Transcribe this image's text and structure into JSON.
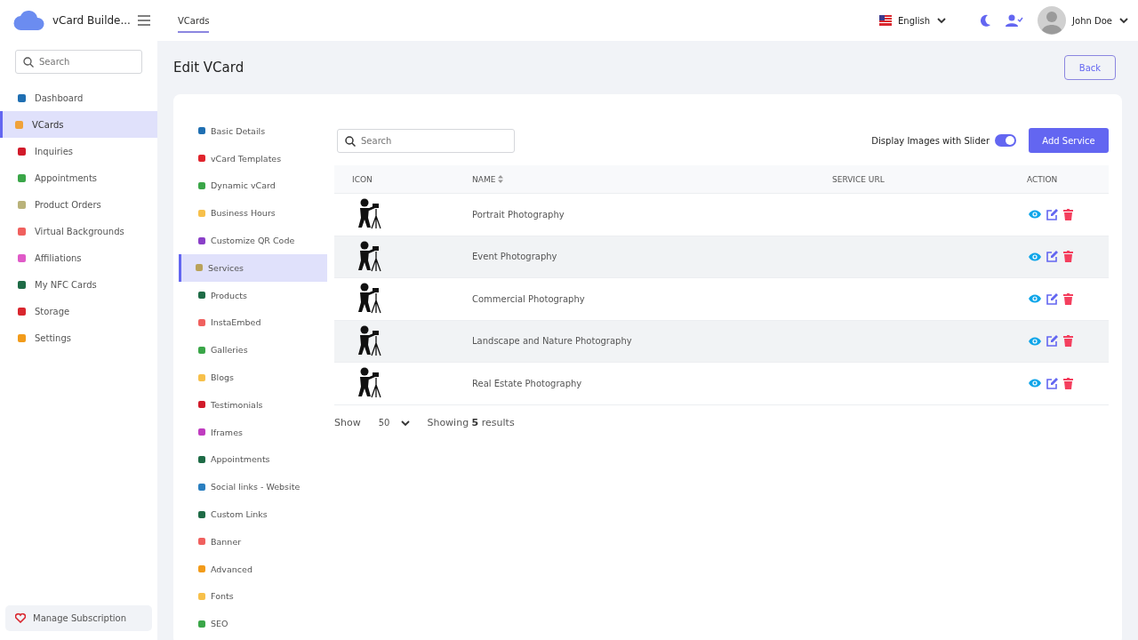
{
  "brand": {
    "name": "vCard Builde..."
  },
  "top_nav": [
    {
      "label": "VCards",
      "selected": true
    }
  ],
  "header": {
    "language": "English",
    "user": "John Doe"
  },
  "sidebar": {
    "search": {
      "placeholder": "Search"
    },
    "items": [
      {
        "label": "Dashboard",
        "selected": false,
        "color": "#1f6fb2"
      },
      {
        "label": "VCards",
        "selected": true,
        "color": "#f0a23a"
      },
      {
        "label": "Inquiries",
        "selected": false,
        "color": "#d11a2a"
      },
      {
        "label": "Appointments",
        "selected": false,
        "color": "#3aa648"
      },
      {
        "label": "Product Orders",
        "selected": false,
        "color": "#b9b27a"
      },
      {
        "label": "Virtual Backgrounds",
        "selected": false,
        "color": "#f0605e"
      },
      {
        "label": "Affiliations",
        "selected": false,
        "color": "#e05ac8"
      },
      {
        "label": "My NFC Cards",
        "selected": false,
        "color": "#1e6b46"
      },
      {
        "label": "Storage",
        "selected": false,
        "color": "#d9262e"
      },
      {
        "label": "Settings",
        "selected": false,
        "color": "#f29b1a"
      }
    ],
    "footer": "Manage Subscription"
  },
  "page": {
    "title": "Edit VCard",
    "back": "Back"
  },
  "sections": [
    {
      "label": "Basic Details",
      "selected": false,
      "color": "#1f6fb2"
    },
    {
      "label": "vCard Templates",
      "selected": false,
      "color": "#e0242c"
    },
    {
      "label": "Dynamic vCard",
      "selected": false,
      "color": "#3aa648"
    },
    {
      "label": "Business Hours",
      "selected": false,
      "color": "#f7c04a"
    },
    {
      "label": "Customize QR Code",
      "selected": false,
      "color": "#8a3fc8"
    },
    {
      "label": "Services",
      "selected": true,
      "color": "#b9a25a"
    },
    {
      "label": "Products",
      "selected": false,
      "color": "#1e6b46"
    },
    {
      "label": "InstaEmbed",
      "selected": false,
      "color": "#f0605e"
    },
    {
      "label": "Galleries",
      "selected": false,
      "color": "#3aa648"
    },
    {
      "label": "Blogs",
      "selected": false,
      "color": "#f7c04a"
    },
    {
      "label": "Testimonials",
      "selected": false,
      "color": "#d11a2a"
    },
    {
      "label": "Iframes",
      "selected": false,
      "color": "#c03cc0"
    },
    {
      "label": "Appointments",
      "selected": false,
      "color": "#1e6b46"
    },
    {
      "label": "Social links - Website",
      "selected": false,
      "color": "#2a7fc0"
    },
    {
      "label": "Custom Links",
      "selected": false,
      "color": "#1e6b46"
    },
    {
      "label": "Banner",
      "selected": false,
      "color": "#f0605e"
    },
    {
      "label": "Advanced",
      "selected": false,
      "color": "#f29b1a"
    },
    {
      "label": "Fonts",
      "selected": false,
      "color": "#f7c04a"
    },
    {
      "label": "SEO",
      "selected": false,
      "color": "#3aa648"
    }
  ],
  "toolbar": {
    "search": {
      "placeholder": "Search"
    },
    "slider_toggle": {
      "label": "Display Images with Slider",
      "on": true
    },
    "add": "Add Service"
  },
  "table": {
    "columns": [
      "ICON",
      "NAME",
      "SERVICE URL",
      "ACTION"
    ],
    "rows": [
      {
        "name": "Portrait Photography"
      },
      {
        "name": "Event Photography"
      },
      {
        "name": "Commercial Photography"
      },
      {
        "name": "Landscape and Nature Photography"
      },
      {
        "name": "Real Estate Photography"
      }
    ]
  },
  "pagination": {
    "show": "Show",
    "per_page": "50",
    "summary": "Showing **5** results"
  }
}
